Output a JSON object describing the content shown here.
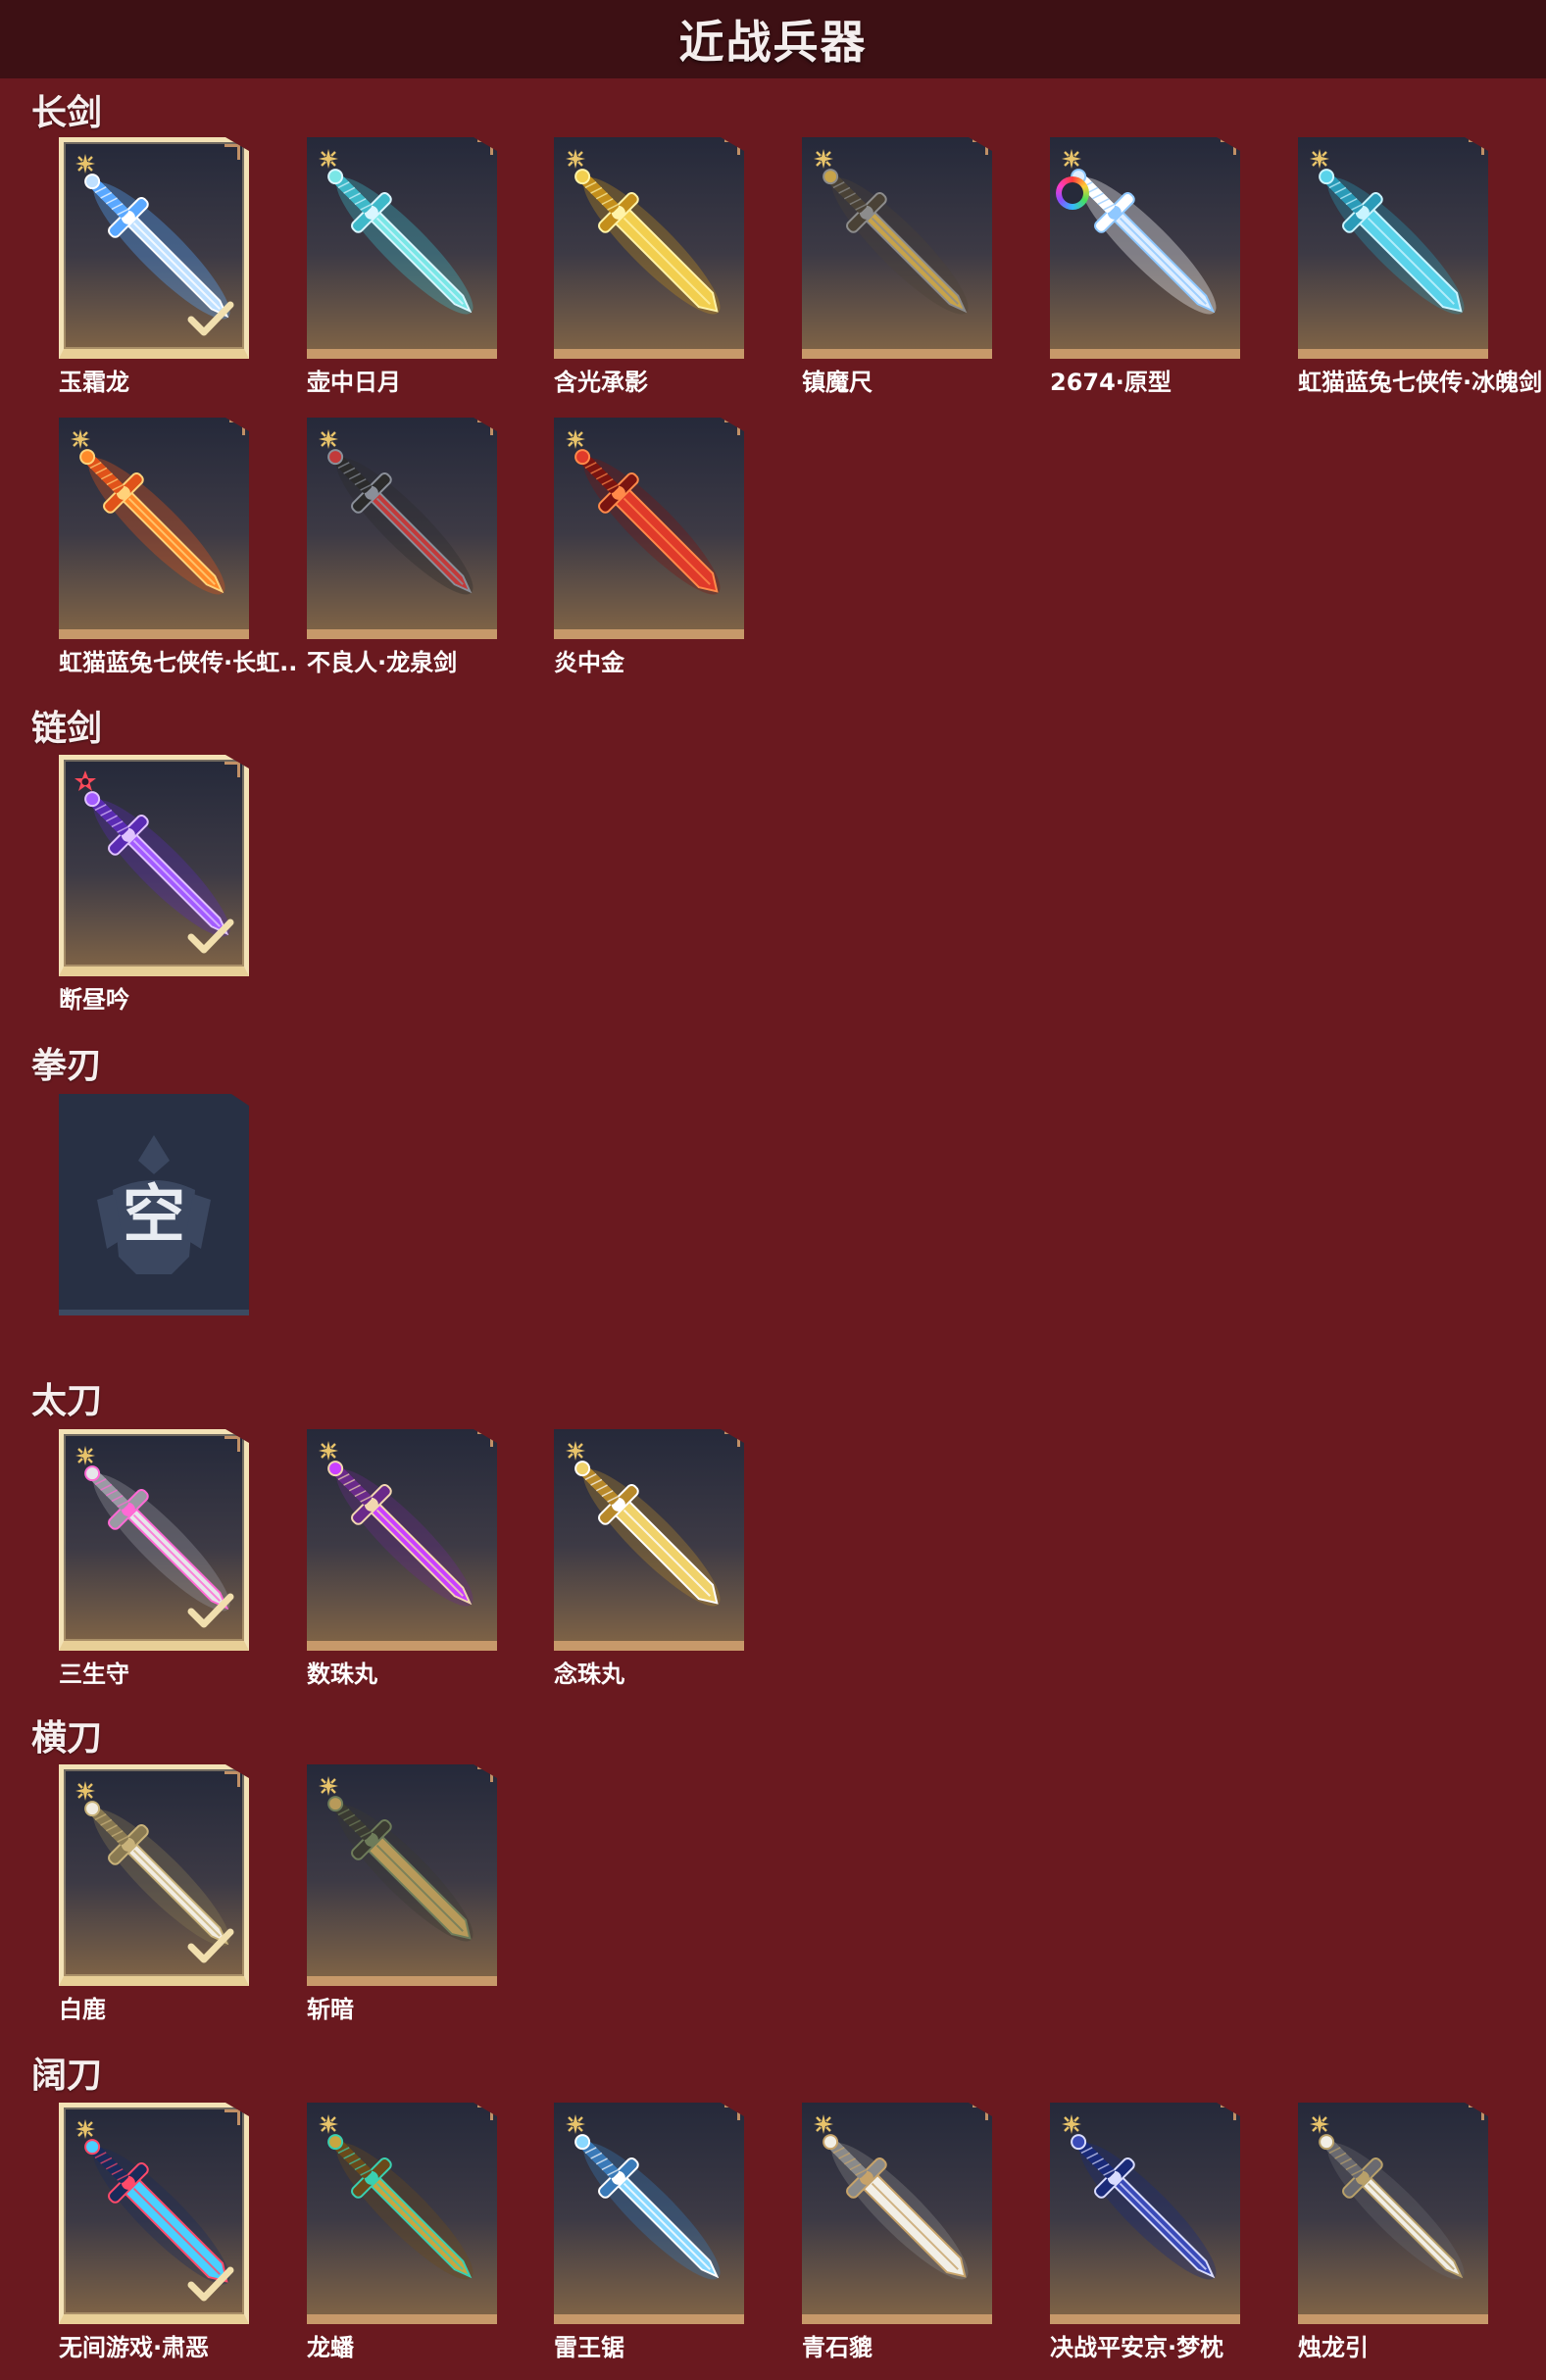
{
  "header": {
    "title": "近战兵器"
  },
  "categories": [
    {
      "label": "长剑",
      "items": [
        {
          "name": "玉霜龙",
          "selected": true,
          "rarity": "gold",
          "colors": [
            "#bfe0ff",
            "#ffffff",
            "#5aa8ff"
          ]
        },
        {
          "name": "壶中日月",
          "selected": false,
          "rarity": "gold",
          "colors": [
            "#7ae6e6",
            "#d9f6ff",
            "#3fb9c9"
          ]
        },
        {
          "name": "含光承影",
          "selected": false,
          "rarity": "gold",
          "colors": [
            "#f2cf4f",
            "#fff3a8",
            "#c48f1c"
          ]
        },
        {
          "name": "镇魔尺",
          "selected": false,
          "rarity": "gold",
          "colors": [
            "#c7a34a",
            "#8c8c8c",
            "#4a4236"
          ]
        },
        {
          "name": "2674·原型",
          "selected": false,
          "rarity": "gold",
          "rainbow": true,
          "colors": [
            "#dfeeff",
            "#8fc8ff",
            "#ffffff"
          ]
        },
        {
          "name": "虹猫蓝兔七侠传·冰魄剑",
          "selected": false,
          "rarity": "gold",
          "colors": [
            "#5ad3ea",
            "#c9f4ff",
            "#2a9bb8"
          ]
        },
        {
          "name": "虹猫蓝兔七侠传·长虹剑",
          "display": "虹猫蓝兔七侠传·长虹..",
          "selected": false,
          "rarity": "gold",
          "colors": [
            "#ff8a2a",
            "#ffd27a",
            "#e0521a"
          ]
        },
        {
          "name": "不良人·龙泉剑",
          "selected": false,
          "rarity": "gold",
          "colors": [
            "#c23a3a",
            "#8a8f99",
            "#2b2b2b"
          ]
        },
        {
          "name": "炎中金",
          "selected": false,
          "rarity": "gold",
          "colors": [
            "#e03a2a",
            "#ff8a4a",
            "#7a1410"
          ]
        }
      ]
    },
    {
      "label": "链剑",
      "items": [
        {
          "name": "断昼吟",
          "selected": true,
          "rarity": "red",
          "colors": [
            "#a35cff",
            "#e0c2ff",
            "#5a2bb3"
          ]
        }
      ]
    },
    {
      "label": "拳刃",
      "items": [],
      "empty": "空"
    },
    {
      "label": "太刀",
      "items": [
        {
          "name": "三生守",
          "selected": true,
          "rarity": "gold",
          "colors": [
            "#e6e6ea",
            "#ff6ad5",
            "#9a9aa4"
          ]
        },
        {
          "name": "数珠丸",
          "selected": false,
          "rarity": "gold",
          "colors": [
            "#c940ff",
            "#f2d7b0",
            "#6a2a8a"
          ]
        },
        {
          "name": "念珠丸",
          "selected": false,
          "rarity": "gold",
          "colors": [
            "#f0d26a",
            "#ffffff",
            "#b8892a"
          ]
        }
      ]
    },
    {
      "label": "横刀",
      "items": [
        {
          "name": "白鹿",
          "selected": true,
          "rarity": "gold",
          "colors": [
            "#f2ede2",
            "#c8b27a",
            "#8a7a52"
          ]
        },
        {
          "name": "斩暗",
          "selected": false,
          "rarity": "gold",
          "colors": [
            "#b89a5a",
            "#6e7c5a",
            "#3a3a32"
          ]
        }
      ]
    },
    {
      "label": "阔刀",
      "items": [
        {
          "name": "无间游戏·肃恶",
          "selected": true,
          "rarity": "gold",
          "colors": [
            "#4ad0ff",
            "#ff4a6a",
            "#1a2a5a"
          ]
        },
        {
          "name": "龙蟠",
          "selected": false,
          "rarity": "gold",
          "colors": [
            "#c9a640",
            "#3ad0b0",
            "#6a4a1a"
          ]
        },
        {
          "name": "雷王锯",
          "selected": false,
          "rarity": "gold",
          "colors": [
            "#8ad8ff",
            "#ffffff",
            "#3a7ab8"
          ]
        },
        {
          "name": "青石貔",
          "selected": false,
          "rarity": "gold",
          "colors": [
            "#f2efe6",
            "#c7a36a",
            "#8a8a8a"
          ]
        },
        {
          "name": "决战平安京·梦枕",
          "selected": false,
          "rarity": "gold",
          "colors": [
            "#3a4ab8",
            "#d9dcff",
            "#1a2a78"
          ]
        },
        {
          "name": "烛龙引",
          "selected": false,
          "rarity": "gold",
          "colors": [
            "#f2efe6",
            "#b8a06a",
            "#6a6a70"
          ]
        }
      ]
    }
  ]
}
